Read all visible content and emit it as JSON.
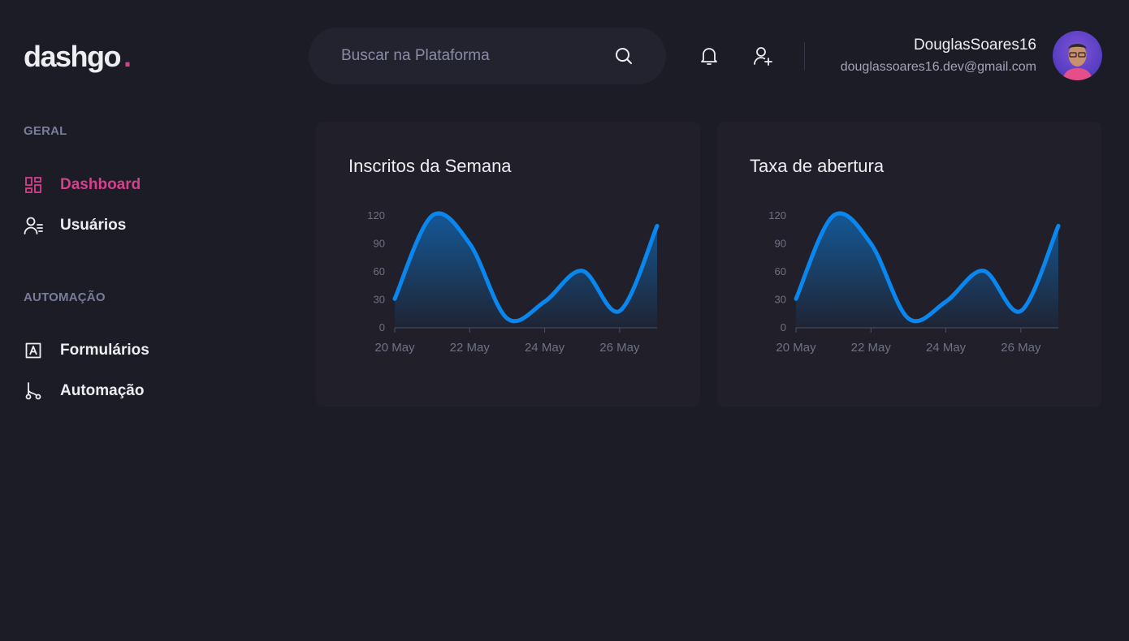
{
  "app": {
    "logo_text": "dashgo",
    "logo_dot": ".",
    "accent": "#d53f8c"
  },
  "header": {
    "search_placeholder": "Buscar na Plataforma",
    "search_icon": "search-icon",
    "notification_icon": "bell-icon",
    "add_user_icon": "user-plus-icon"
  },
  "profile": {
    "name": "DouglasSoares16",
    "email": "douglassoares16.dev@gmail.com"
  },
  "sidebar": {
    "sections": [
      {
        "title": "GERAL",
        "items": [
          {
            "label": "Dashboard",
            "icon": "dashboard-icon",
            "active": true
          },
          {
            "label": "Usuários",
            "icon": "users-list-icon",
            "active": false
          }
        ]
      },
      {
        "title": "AUTOMAÇÃO",
        "items": [
          {
            "label": "Formulários",
            "icon": "form-icon",
            "active": false
          },
          {
            "label": "Automação",
            "icon": "git-branch-icon",
            "active": false
          }
        ]
      }
    ]
  },
  "charts": [
    {
      "title": "Inscritos da Semana"
    },
    {
      "title": "Taxa de abertura"
    }
  ],
  "chart_data": [
    {
      "type": "area",
      "title": "Inscritos da Semana",
      "x": [
        "2021-05-20",
        "2021-05-21",
        "2021-05-22",
        "2021-05-23",
        "2021-05-24",
        "2021-05-25",
        "2021-05-26",
        "2021-05-27"
      ],
      "series": [
        {
          "values": [
            31,
            120,
            90,
            10,
            28,
            61,
            18,
            109
          ]
        }
      ],
      "xticks": [
        "20 May",
        "22 May",
        "24 May",
        "26 May"
      ],
      "yticks": [
        0,
        30,
        60,
        90,
        120
      ],
      "ylim": [
        0,
        125
      ],
      "color": "#0a87ef",
      "grid": false
    },
    {
      "type": "area",
      "title": "Taxa de abertura",
      "x": [
        "2021-05-20",
        "2021-05-21",
        "2021-05-22",
        "2021-05-23",
        "2021-05-24",
        "2021-05-25",
        "2021-05-26",
        "2021-05-27"
      ],
      "series": [
        {
          "values": [
            31,
            120,
            90,
            10,
            28,
            61,
            18,
            109
          ]
        }
      ],
      "xticks": [
        "20 May",
        "22 May",
        "24 May",
        "26 May"
      ],
      "yticks": [
        0,
        30,
        60,
        90,
        120
      ],
      "ylim": [
        0,
        125
      ],
      "color": "#0a87ef",
      "grid": false
    }
  ]
}
